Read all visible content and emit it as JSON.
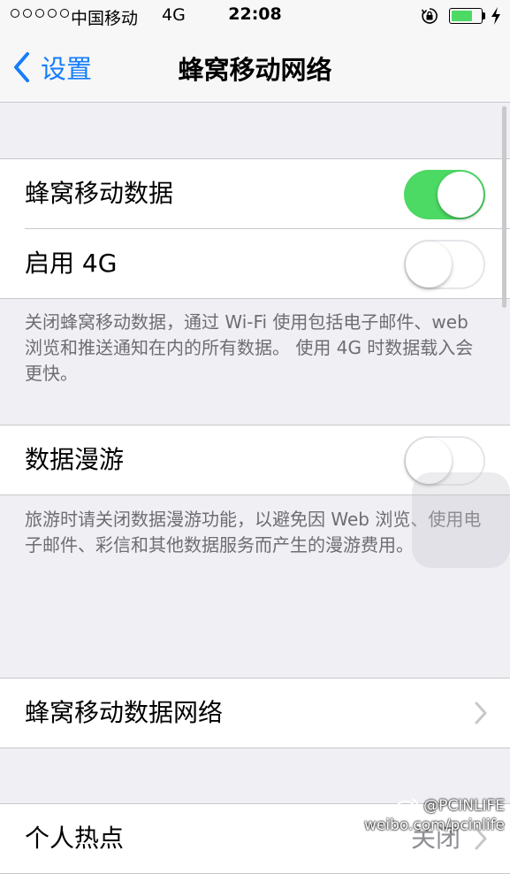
{
  "status_bar": {
    "carrier": "中国移动",
    "network": "4G",
    "time": "22:08",
    "battery_level": 0.75,
    "accent_color": "#4cd964"
  },
  "nav": {
    "back_label": "设置",
    "title": "蜂窝移动网络",
    "tint_color": "#157efb"
  },
  "sections": {
    "cellular": {
      "rows": [
        {
          "label": "蜂窝移动数据",
          "toggle_on": true
        },
        {
          "label": "启用 4G",
          "toggle_on": false
        }
      ],
      "footer": "关闭蜂窝移动数据，通过 Wi-Fi 使用包括电子邮件、web 浏览和推送通知在内的所有数据。 使用 4G 时数据载入会更快。"
    },
    "roaming": {
      "rows": [
        {
          "label": "数据漫游",
          "toggle_on": false
        }
      ],
      "footer": "旅游时请关闭数据漫游功能，以避免因 Web 浏览、使用电子邮件、彩信和其他数据服务而产生的漫游费用。"
    },
    "network": {
      "rows": [
        {
          "label": "蜂窝移动数据网络"
        }
      ]
    },
    "hotspot": {
      "rows": [
        {
          "label": "个人热点",
          "value": "关闭"
        }
      ]
    }
  },
  "watermark": {
    "handle": "@PCINLIFE",
    "url": "weibo.com/pcinlife"
  }
}
